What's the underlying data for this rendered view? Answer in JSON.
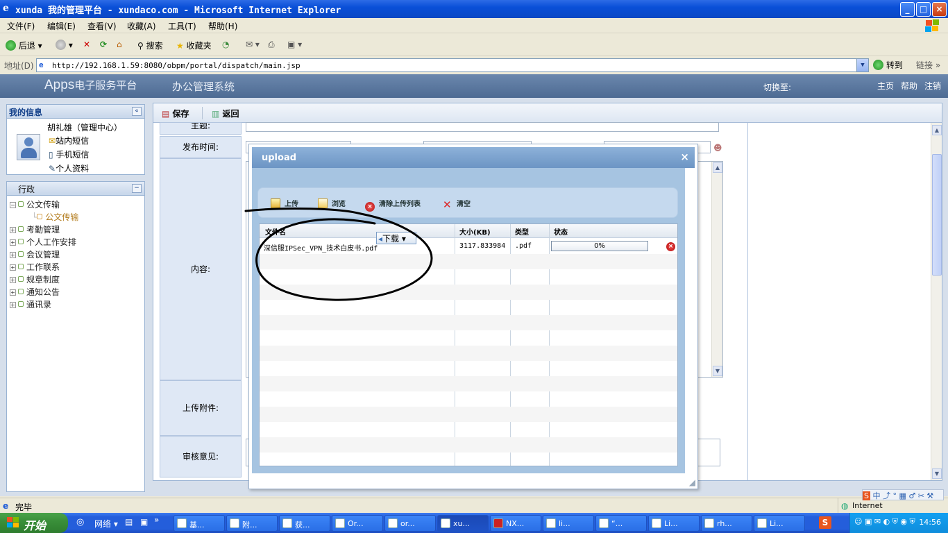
{
  "window": {
    "title": "xunda 我的管理平台 - xundaco.com - Microsoft Internet Explorer",
    "min": "_",
    "max": "□",
    "close": "×"
  },
  "menu": [
    "文件(F)",
    "编辑(E)",
    "查看(V)",
    "收藏(A)",
    "工具(T)",
    "帮助(H)"
  ],
  "toolbar": {
    "back": "后退",
    "search": "搜索",
    "favorites": "收藏夹"
  },
  "address": {
    "label": "地址(D)",
    "url": "http://192.168.1.59:8080/obpm/portal/dispatch/main.jsp",
    "go": "转到",
    "links": "链接"
  },
  "header": {
    "logo_main": "Apps",
    "logo_sub": "电子服务平台",
    "system": "办公管理系统",
    "switch_to": "切换至:",
    "home": "主页",
    "help": "帮助",
    "logout": "注销"
  },
  "my_info": {
    "title": "我的信息",
    "user": "胡礼雄（管理中心）",
    "links": [
      "站内短信",
      "手机短信",
      "个人资料"
    ]
  },
  "nav": {
    "title": "行政",
    "items": [
      {
        "label": "公文传输",
        "expanded": true
      },
      {
        "label": "公文传输",
        "child": true
      },
      {
        "label": "考勤管理"
      },
      {
        "label": "个人工作安排"
      },
      {
        "label": "会议管理"
      },
      {
        "label": "工作联系"
      },
      {
        "label": "规章制度"
      },
      {
        "label": "通知公告"
      },
      {
        "label": "通讯录"
      }
    ]
  },
  "form": {
    "save": "保存",
    "back": "返回",
    "field_subject": "主题:",
    "field_publish_time": "发布时间:",
    "field_content": "内容:",
    "field_attachment": "上传附件:",
    "field_review": "审核意见:"
  },
  "upload_dialog": {
    "title": "upload",
    "close": "×",
    "actions": [
      "上传",
      "浏览",
      "清除上传列表",
      "清空"
    ],
    "columns": [
      "文件名",
      "大小(KB)",
      "类型",
      "状态"
    ],
    "rows": [
      {
        "name": "深信服IPSec_VPN_技术白皮书.pdf",
        "size": "3117.833984",
        "type": ".pdf",
        "status": "0%",
        "progress": 0
      }
    ],
    "download_label": "下载"
  },
  "statusbar": {
    "status": "完毕",
    "zone": "Internet"
  },
  "taskbar": {
    "start": "开始",
    "quick": "网络",
    "tasks": [
      "基...",
      "附...",
      "获...",
      "Or...",
      "or...",
      "xu...",
      "NX...",
      "li...",
      "“...",
      "Li...",
      "rh...",
      "Li..."
    ],
    "active_index": 5,
    "time": "14:56"
  },
  "colors": {
    "header_bg": "#5a789f",
    "dialog_head": "#7ba3d0",
    "taskbar": "#245edb",
    "start": "#3a8f3a"
  }
}
